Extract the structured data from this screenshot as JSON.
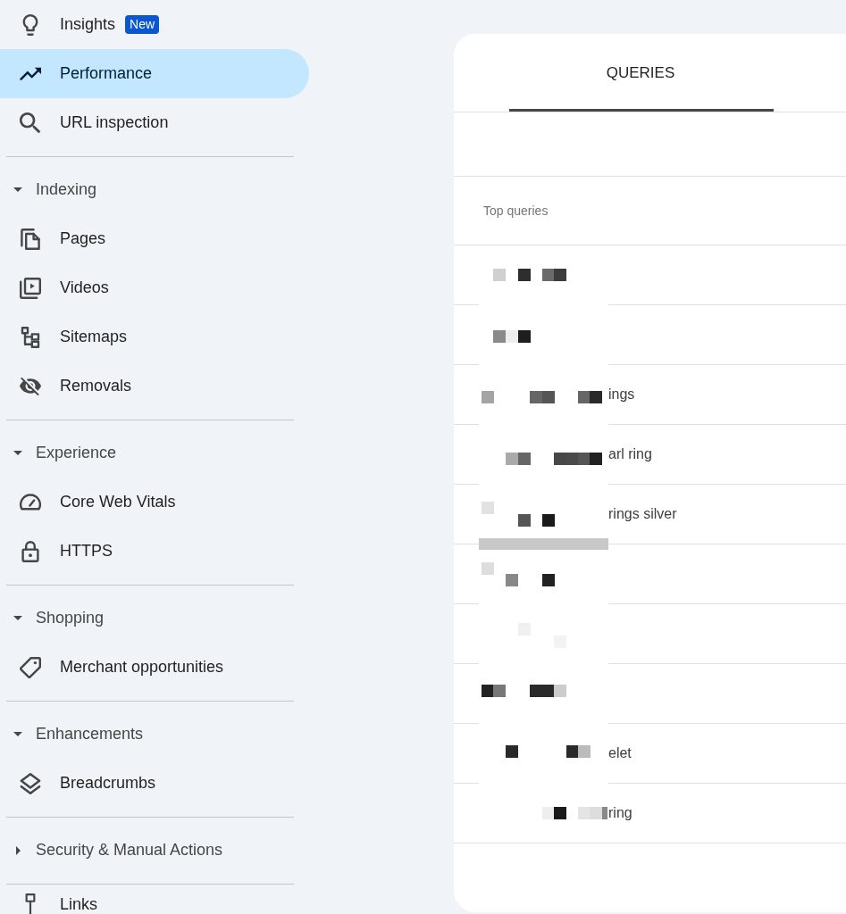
{
  "nav": {
    "groups": [
      {
        "items": [
          {
            "label": "Insights",
            "badge": "New",
            "selected": false
          },
          {
            "label": "Performance",
            "selected": true
          },
          {
            "label": "URL inspection",
            "selected": false
          }
        ]
      },
      {
        "title": "Indexing",
        "expanded": true,
        "items": [
          {
            "label": "Pages",
            "selected": false
          },
          {
            "label": "Videos",
            "selected": false
          },
          {
            "label": "Sitemaps",
            "selected": false
          },
          {
            "label": "Removals",
            "selected": false
          }
        ]
      },
      {
        "title": "Experience",
        "expanded": true,
        "items": [
          {
            "label": "Core Web Vitals",
            "selected": false
          },
          {
            "label": "HTTPS",
            "selected": false
          }
        ]
      },
      {
        "title": "Shopping",
        "expanded": true,
        "items": [
          {
            "label": "Merchant opportunities",
            "selected": false
          }
        ]
      },
      {
        "title": "Enhancements",
        "expanded": true,
        "items": [
          {
            "label": "Breadcrumbs",
            "selected": false
          }
        ]
      },
      {
        "title": "Security & Manual Actions",
        "expanded": false
      },
      {
        "items": [
          {
            "label": "Links",
            "selected": false
          }
        ]
      }
    ]
  },
  "report": {
    "tabs": [
      {
        "label": "QUERIES",
        "selected": true
      }
    ],
    "table": {
      "header": "Top queries",
      "rows": [
        {},
        {},
        {
          "query": "ings"
        },
        {
          "query": "arl ring"
        },
        {
          "query": "rings silver"
        },
        {},
        {},
        {},
        {
          "query": "elet"
        },
        {
          "query": "ring"
        }
      ]
    }
  }
}
